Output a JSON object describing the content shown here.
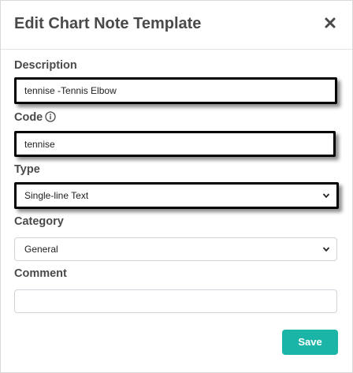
{
  "modal": {
    "title": "Edit Chart Note Template",
    "close_icon": "close-icon"
  },
  "form": {
    "description": {
      "label": "Description",
      "value": "tennise -Tennis Elbow"
    },
    "code": {
      "label": "Code",
      "info_icon": "info-icon",
      "value": "tennise"
    },
    "type": {
      "label": "Type",
      "selected": "Single-line Text"
    },
    "category": {
      "label": "Category",
      "selected": "General"
    },
    "comment": {
      "label": "Comment",
      "value": ""
    }
  },
  "actions": {
    "save_label": "Save"
  },
  "colors": {
    "save_button": "#1bb5a8",
    "highlight_border": "#000000",
    "title_text": "#4a4a4a"
  }
}
